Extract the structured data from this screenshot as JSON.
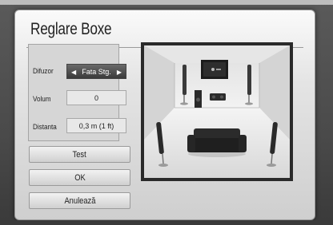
{
  "dialog": {
    "title": "Reglare Boxe"
  },
  "settings": {
    "speaker_label": "Difuzor",
    "speaker_value": "Fata Stg.",
    "volume_label": "Volum",
    "volume_value": "0",
    "distance_label": "Distanta",
    "distance_value": "0,3 m (1 ft)"
  },
  "buttons": {
    "test": "Test",
    "ok": "OK",
    "cancel": "Anulează"
  },
  "colors": {
    "selected_field": "#4a4a4a",
    "dialog_bg": "#e4e4e4",
    "frame_border": "#2a2a2a"
  },
  "icons": {
    "prev": "left-arrow-icon",
    "next": "right-arrow-icon"
  }
}
